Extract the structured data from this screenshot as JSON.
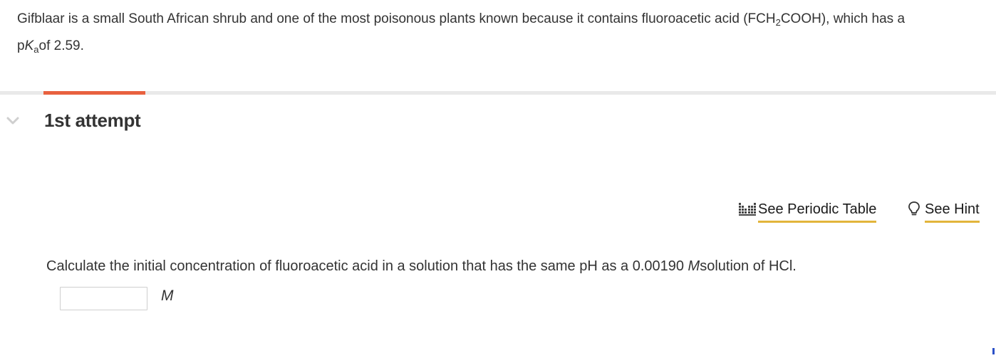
{
  "problem": {
    "intro_before_formula": "Gifblaar is a small South African shrub and one of the most poisonous plants known because it contains fluoroacetic acid (FCH",
    "formula_sub": "2",
    "intro_after_formula": "COOH), which has a",
    "pka_p": "p",
    "pka_K": "K",
    "pka_sub": "a",
    "pka_text": "of 2.59."
  },
  "attempt": {
    "title": "1st attempt",
    "progress_color": "#e8613f"
  },
  "tools": {
    "periodic_table_label": "See Periodic Table",
    "periodic_table_icon": "periodic-table-icon",
    "hint_label": "See Hint",
    "hint_icon": "lightbulb-icon",
    "underline_color": "#e2b53b"
  },
  "question": {
    "text_before": "Calculate the initial concentration of fluoroacetic acid in a solution that has the same pH as a 0.00190 ",
    "unit_italic": "M",
    "text_after": "solution of HCl."
  },
  "answer": {
    "value": "",
    "placeholder": "",
    "unit": "M"
  }
}
